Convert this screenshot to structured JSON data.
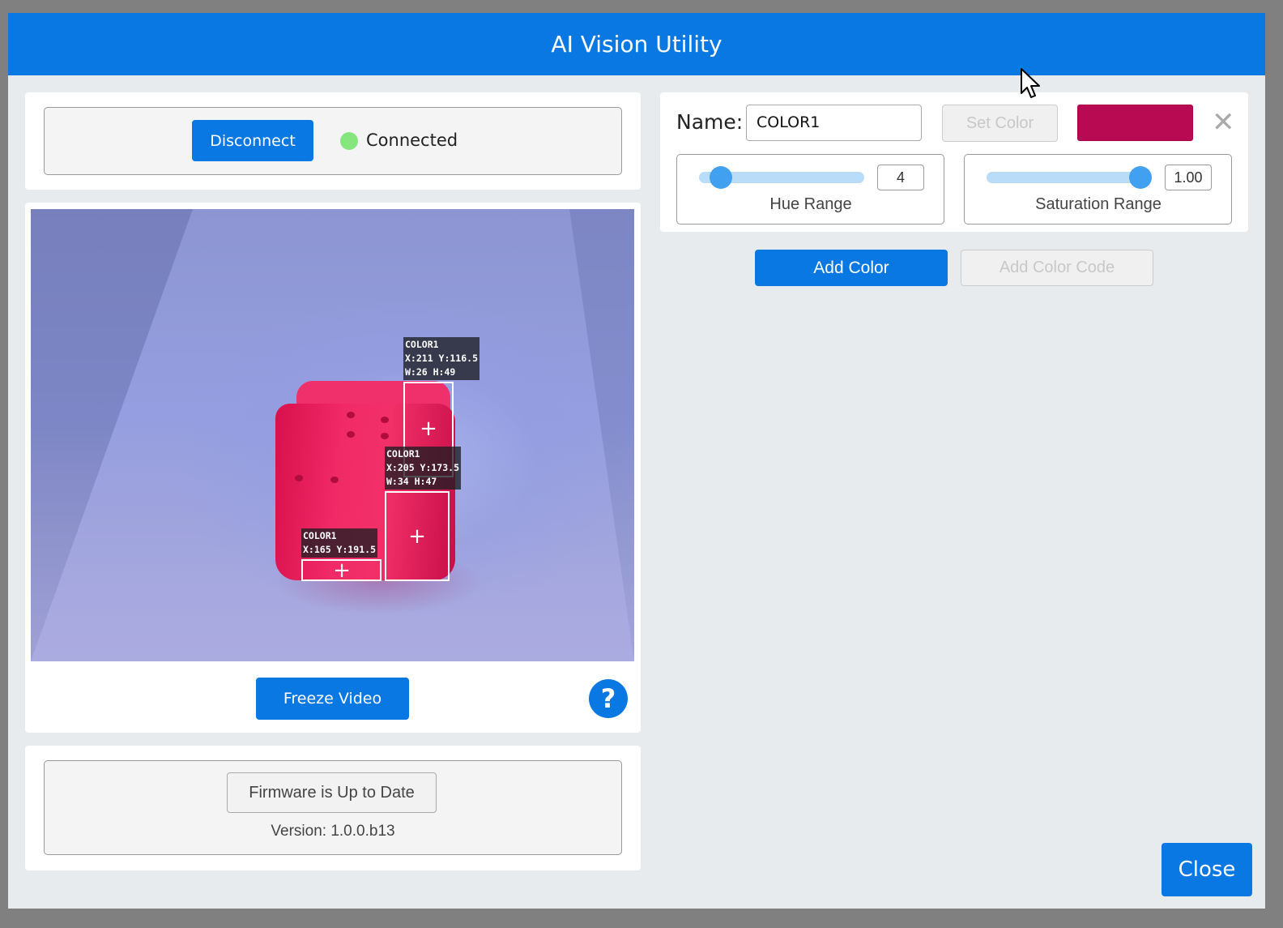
{
  "window": {
    "title": "AI Vision Utility"
  },
  "connection": {
    "button_label": "Disconnect",
    "status": "Connected",
    "status_color": "#86e67e"
  },
  "video": {
    "detections": [
      {
        "label": "COLOR1\nX:211 Y:116.5\nW:26 H:49"
      },
      {
        "label": "COLOR1\nX:205 Y:173.5\nW:34 H:47"
      },
      {
        "label": "COLOR1\nX:165 Y:191.5"
      }
    ],
    "freeze_label": "Freeze Video",
    "help_glyph": "?"
  },
  "firmware": {
    "button_label": "Firmware is Up to Date",
    "version": "Version: 1.0.0.b13"
  },
  "color_config": {
    "name_label": "Name:",
    "name_value": "COLOR1",
    "set_color_label": "Set Color",
    "swatch_color": "#b80a52",
    "hue": {
      "value": "4",
      "caption": "Hue Range",
      "fraction": 0.05
    },
    "saturation": {
      "value": "1.00",
      "caption": "Saturation Range",
      "fraction": 1.0
    },
    "close_glyph": "✕"
  },
  "actions": {
    "add_color": "Add Color",
    "add_color_code": "Add Color Code",
    "close": "Close"
  },
  "colors": {
    "accent": "#0a78e2",
    "background": "#e8ebee"
  }
}
